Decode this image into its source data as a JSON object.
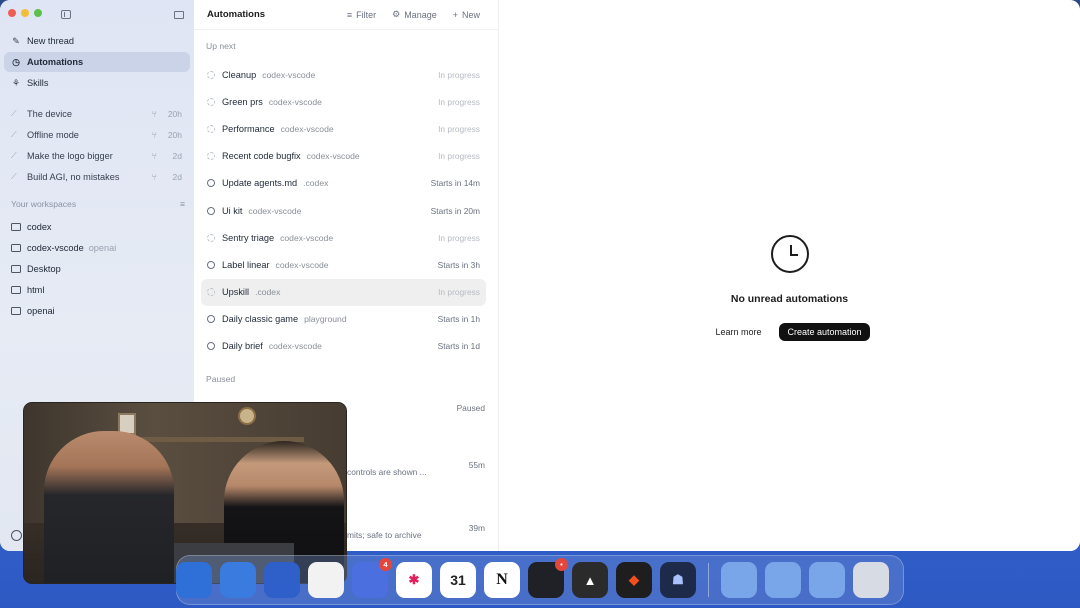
{
  "sidebar": {
    "nav": [
      {
        "label": "New thread",
        "icon": "edit-icon"
      },
      {
        "label": "Automations",
        "icon": "clock-icon",
        "active": true
      },
      {
        "label": "Skills",
        "icon": "skills-icon"
      }
    ],
    "threads": [
      {
        "label": "The device",
        "age": "20h"
      },
      {
        "label": "Offline mode",
        "age": "20h"
      },
      {
        "label": "Make the logo bigger",
        "age": "2d"
      },
      {
        "label": "Build AGI, no mistakes",
        "age": "2d"
      }
    ],
    "workspaces_header": "Your workspaces",
    "workspaces": [
      {
        "label": "codex",
        "sub": ""
      },
      {
        "label": "codex-vscode",
        "sub": "openai"
      },
      {
        "label": "Desktop",
        "sub": ""
      },
      {
        "label": "html",
        "sub": ""
      },
      {
        "label": "openai",
        "sub": ""
      }
    ]
  },
  "list": {
    "title": "Automations",
    "actions": {
      "filter": "Filter",
      "manage": "Manage",
      "new": "New"
    },
    "up_next_label": "Up next",
    "paused_label": "Paused",
    "rows": [
      {
        "name": "Cleanup",
        "project": "codex-vscode",
        "status": "In progress",
        "in_progress": true
      },
      {
        "name": "Green prs",
        "project": "codex-vscode",
        "status": "In progress",
        "in_progress": true
      },
      {
        "name": "Performance",
        "project": "codex-vscode",
        "status": "In progress",
        "in_progress": true
      },
      {
        "name": "Recent code bugfix",
        "project": "codex-vscode",
        "status": "In progress",
        "in_progress": true
      },
      {
        "name": "Update agents.md",
        "project": ".codex",
        "status": "Starts in 14m",
        "in_progress": false
      },
      {
        "name": "Ui kit",
        "project": "codex-vscode",
        "status": "Starts in 20m",
        "in_progress": false
      },
      {
        "name": "Sentry triage",
        "project": "codex-vscode",
        "status": "In progress",
        "in_progress": true
      },
      {
        "name": "Label linear",
        "project": "codex-vscode",
        "status": "Starts in 3h",
        "in_progress": false
      },
      {
        "name": "Upskill",
        "project": ".codex",
        "status": "In progress",
        "in_progress": true,
        "highlighted": true
      },
      {
        "name": "Daily classic game",
        "project": "playground",
        "status": "Starts in 1h",
        "in_progress": false
      },
      {
        "name": "Daily brief",
        "project": "codex-vscode",
        "status": "Starts in 1d",
        "in_progress": false
      }
    ],
    "paused_rows": [
      {
        "status": "Paused"
      },
      {
        "status": "55m",
        "partial_text": "controls are shown ..."
      },
      {
        "status": "39m",
        "partial_text": "mits; safe to archive"
      }
    ]
  },
  "main": {
    "empty_title": "No unread automations",
    "learn_more": "Learn more",
    "create": "Create automation"
  },
  "dock": {
    "badges": {
      "mail": "4",
      "linear": "•"
    },
    "calendar_day": "31",
    "notion_letter": "N"
  }
}
